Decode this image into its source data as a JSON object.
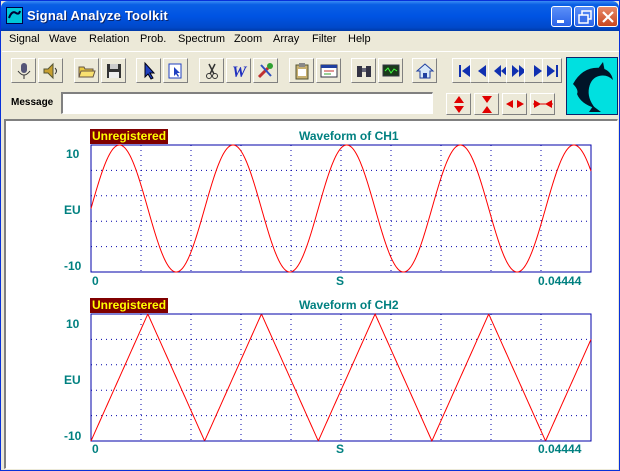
{
  "window": {
    "title": "Signal Analyze Toolkit"
  },
  "menu": [
    "Signal",
    "Wave",
    "Relation",
    "Prob.",
    "Spectrum",
    "Zoom",
    "Array",
    "Filter",
    "Help"
  ],
  "toolbar": {
    "message_label": "Message",
    "message_value": "",
    "tools": [
      "microphone-icon",
      "speaker-icon",
      "open-folder-icon",
      "save-disk-icon",
      "pointer-icon",
      "zoom-select-icon",
      "cut-icon",
      "waveform-w-icon",
      "tools-icon",
      "clipboard-icon",
      "properties-icon",
      "binoculars-icon",
      "display-icon",
      "home-icon"
    ],
    "nav": [
      "first-icon",
      "prev-icon",
      "rewind-icon",
      "fast-forward-icon",
      "next-icon",
      "last-icon"
    ],
    "adjust": [
      "expand-vertical-icon",
      "compress-vertical-icon",
      "expand-horizontal-icon",
      "compress-horizontal-icon"
    ]
  },
  "colors": {
    "trace": "#ff0000",
    "frame": "#0000aa",
    "text": "#008080",
    "grid": "#0000aa",
    "badge_bg": "#800000",
    "badge_fg": "#ffff00"
  },
  "charts": [
    {
      "badge": "Unregistered",
      "title": "Waveform of CH1",
      "ytop": "10",
      "ymid": "EU",
      "ybottom": "-10",
      "xleft": "0",
      "xmid": "S",
      "xright": "0.04444"
    },
    {
      "badge": "Unregistered",
      "title": "Waveform of CH2",
      "ytop": "10",
      "ymid": "EU",
      "ybottom": "-10",
      "xleft": "0",
      "xmid": "S",
      "xright": "0.04444"
    }
  ],
  "chart_data": [
    {
      "type": "line",
      "title": "Waveform of CH1",
      "xlabel": "S",
      "ylabel": "EU",
      "xlim": [
        0,
        0.04444
      ],
      "ylim": [
        -10,
        10
      ],
      "grid": true,
      "series": [
        {
          "name": "",
          "shape": "sine",
          "amplitude": 10,
          "cycles": 4.4,
          "start_value": 0,
          "start_direction": "rising"
        }
      ]
    },
    {
      "type": "line",
      "title": "Waveform of CH2",
      "xlabel": "S",
      "ylabel": "EU",
      "xlim": [
        0,
        0.04444
      ],
      "ylim": [
        -10,
        10
      ],
      "grid": true,
      "series": [
        {
          "name": "",
          "shape": "triangle",
          "amplitude": 10,
          "cycles": 4.4,
          "start_value": -10,
          "start_direction": "rising"
        }
      ]
    }
  ]
}
